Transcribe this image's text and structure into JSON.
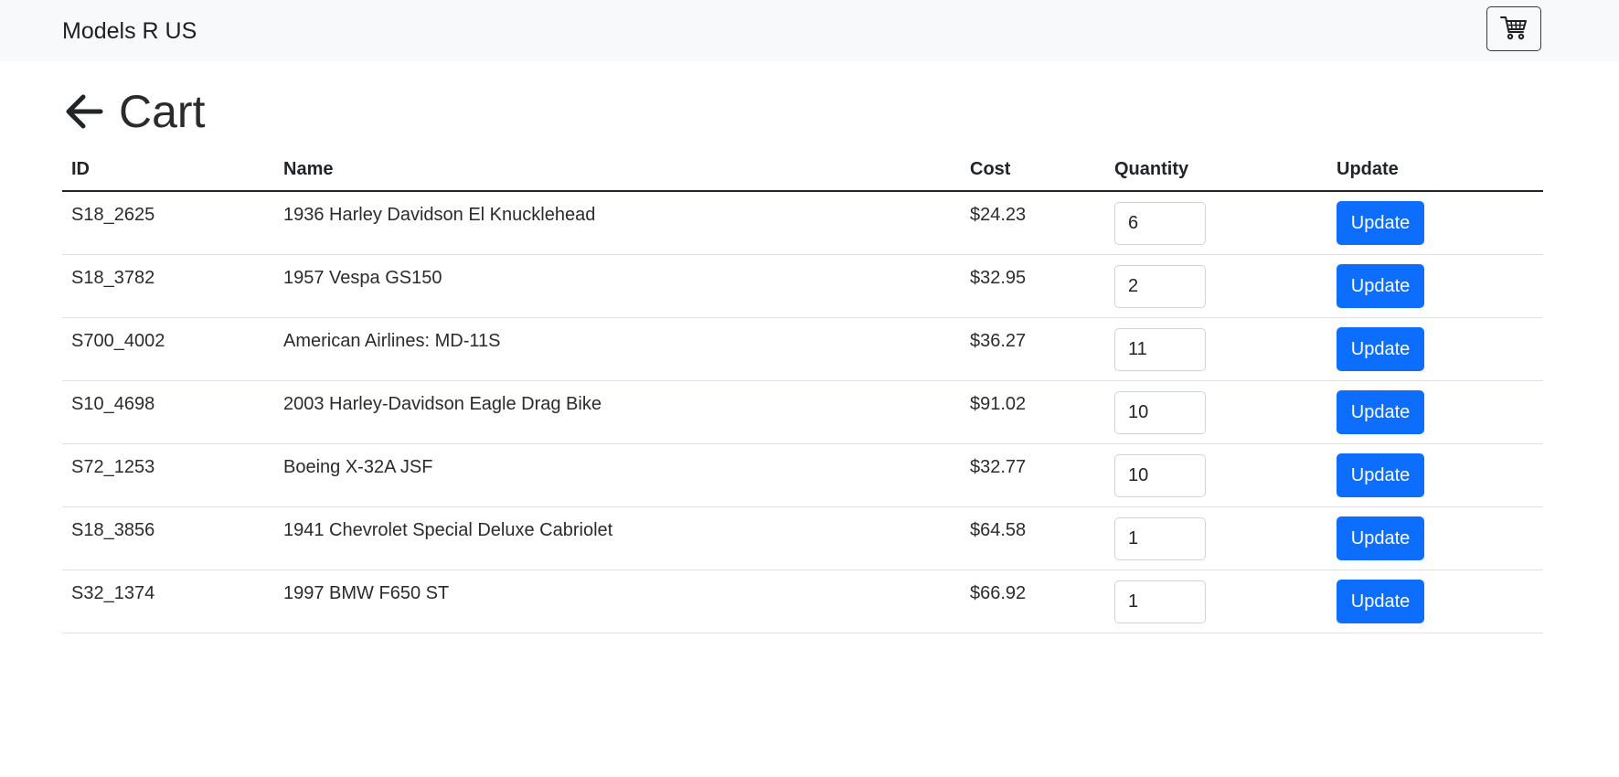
{
  "navbar": {
    "brand": "Models R US",
    "cart_icon": "shopping-cart-icon"
  },
  "header": {
    "back_icon": "arrow-left-icon",
    "title": "Cart"
  },
  "table": {
    "columns": [
      "ID",
      "Name",
      "Cost",
      "Quantity",
      "Update"
    ],
    "rows": [
      {
        "id": "S18_2625",
        "name": "1936 Harley Davidson El Knucklehead",
        "cost": "$24.23",
        "quantity": "6",
        "action": "Update"
      },
      {
        "id": "S18_3782",
        "name": "1957 Vespa GS150",
        "cost": "$32.95",
        "quantity": "2",
        "action": "Update"
      },
      {
        "id": "S700_4002",
        "name": "American Airlines: MD-11S",
        "cost": "$36.27",
        "quantity": "11",
        "action": "Update"
      },
      {
        "id": "S10_4698",
        "name": "2003 Harley-Davidson Eagle Drag Bike",
        "cost": "$91.02",
        "quantity": "10",
        "action": "Update"
      },
      {
        "id": "S72_1253",
        "name": "Boeing X-32A JSF",
        "cost": "$32.77",
        "quantity": "10",
        "action": "Update"
      },
      {
        "id": "S18_3856",
        "name": "1941 Chevrolet Special Deluxe Cabriolet",
        "cost": "$64.58",
        "quantity": "1",
        "action": "Update"
      },
      {
        "id": "S32_1374",
        "name": "1997 BMW F650 ST",
        "cost": "$66.92",
        "quantity": "1",
        "action": "Update"
      }
    ]
  },
  "colors": {
    "navbar_bg": "#f8f9fa",
    "primary": "#0d6efd",
    "text": "#212529"
  }
}
